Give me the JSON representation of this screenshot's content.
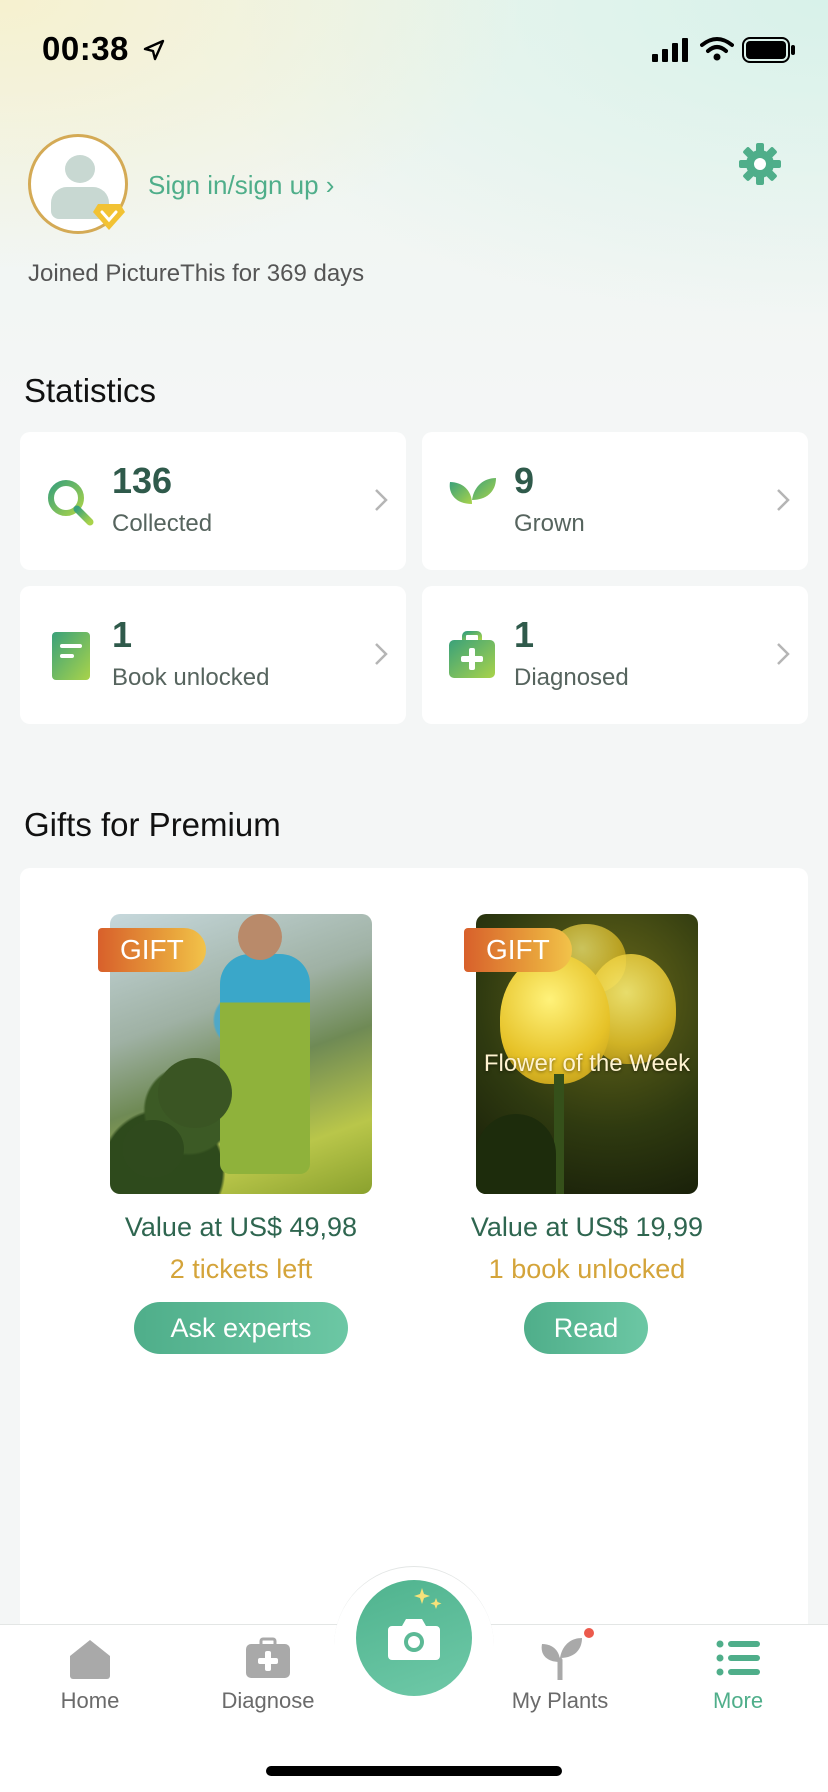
{
  "status_bar": {
    "time": "00:38"
  },
  "profile": {
    "sign_in_label": "Sign in/sign up ›",
    "joined_text": "Joined PictureThis for 369 days"
  },
  "statistics": {
    "title": "Statistics",
    "items": [
      {
        "value": "136",
        "label": "Collected",
        "icon": "search-icon"
      },
      {
        "value": "9",
        "label": "Grown",
        "icon": "sprout-icon"
      },
      {
        "value": "1",
        "label": "Book unlocked",
        "icon": "book-icon"
      },
      {
        "value": "1",
        "label": "Diagnosed",
        "icon": "medkit-icon"
      }
    ]
  },
  "gifts": {
    "title": "Gifts for Premium",
    "items": [
      {
        "tag": "GIFT",
        "value": "Value at US$ 49,98",
        "remaining": "2 tickets left",
        "button": "Ask experts"
      },
      {
        "tag": "GIFT",
        "image_caption": "Flower of the Week",
        "value": "Value at US$ 19,99",
        "remaining": "1 book unlocked",
        "button": "Read"
      }
    ]
  },
  "tabbar": {
    "items": [
      {
        "label": "Home",
        "icon": "home-icon"
      },
      {
        "label": "Diagnose",
        "icon": "diagnose-icon"
      },
      {
        "label": "",
        "icon": "camera-icon"
      },
      {
        "label": "My Plants",
        "icon": "plant-icon"
      },
      {
        "label": "More",
        "icon": "menu-icon"
      }
    ],
    "active": "More"
  },
  "colors": {
    "accent": "#4fae8a",
    "gold": "#d4a43a",
    "dark_green": "#2f5a4b"
  }
}
